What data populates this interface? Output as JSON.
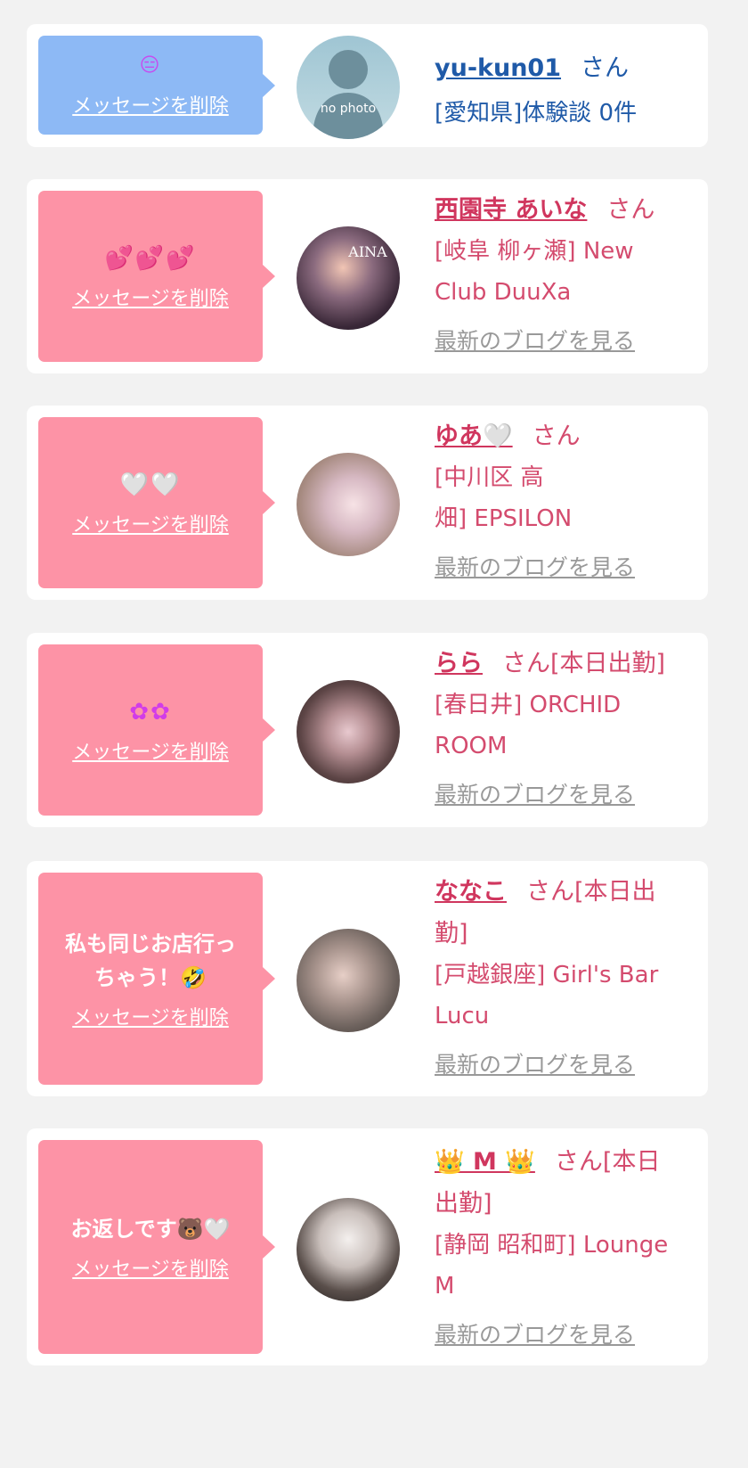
{
  "colors": {
    "page_bg": "#f2f2f2",
    "bubble_blue": "#8db9f5",
    "bubble_pink": "#fd93a6",
    "name_blue": "#1f5aa8",
    "name_pink": "#d0365e",
    "link_gray": "#999999"
  },
  "common": {
    "delete_label": "メッセージを削除",
    "honorific": "さん",
    "blog_link": "最新のブログを見る"
  },
  "cards": [
    {
      "message": "😑",
      "message_icon_name": "expressionless-face-icon",
      "username": "yu-kun01",
      "san": "さん",
      "shop_line1": "[愛知県]体験談 0件",
      "shop_line2": "",
      "avatar_text": "no photo",
      "avatar_icon": "no-photo-silhouette-icon"
    },
    {
      "message": "💕💕💕",
      "message_icon_name": "two-hearts-icon",
      "username": "西園寺 あいな",
      "san": "さん",
      "shop_line1": "[岐阜 柳ヶ瀬] New",
      "shop_line2": "Club DuuXa",
      "avatar_text": "AINA"
    },
    {
      "message": "🤍🤍",
      "message_icon_name": "white-heart-icon",
      "username": "ゆあ🤍",
      "san": "さん",
      "shop_line1": "[中川区 高",
      "shop_line2": "畑] EPSILON"
    },
    {
      "message": "✿✿",
      "message_icon_name": "flower-icon",
      "username": "らら",
      "san": "さん[本日出勤]",
      "shop_line1": "[春日井] ORCHID",
      "shop_line2": "ROOM"
    },
    {
      "message": "私も同じお店行っちゃう！🤣",
      "message_icon_name": "rolling-laughing-face-icon",
      "username": "ななこ",
      "san": "さん[本日出勤]",
      "shop_line1": "[戸越銀座] Girl's Bar",
      "shop_line2": "Lucu"
    },
    {
      "message": "お返しです🐻🤍",
      "message_icon_name": "bear-face-icon",
      "username": "👑 M 👑",
      "san": "さん[本日出勤]",
      "shop_line1": "[静岡 昭和町] Lounge",
      "shop_line2": "M"
    }
  ]
}
